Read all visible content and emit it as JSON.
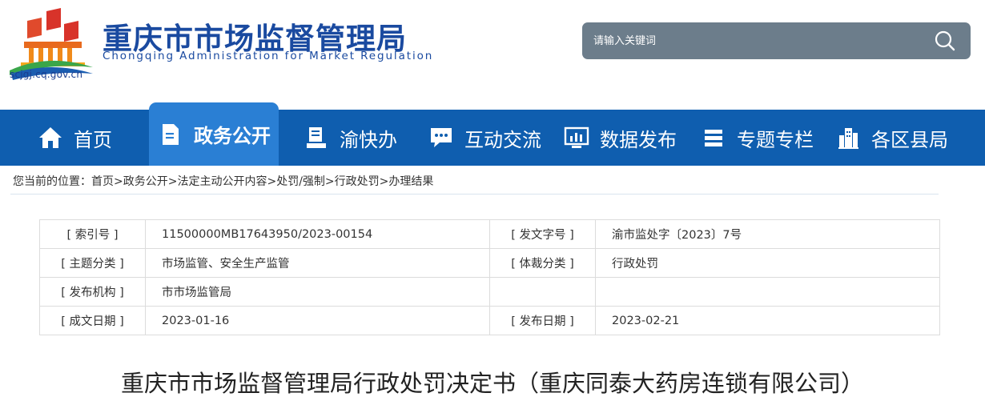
{
  "header": {
    "title_cn": "重庆市市场监督管理局",
    "title_en": "Chongqing Administration for Market Regulation",
    "site_url": "scjgj.cq.gov.cn",
    "logo_icon": "government-building-logo-icon"
  },
  "search": {
    "placeholder": "请输入关键词",
    "icon": "search-icon"
  },
  "nav": {
    "items": [
      {
        "label": "首页",
        "icon": "home-icon"
      },
      {
        "label": "政务公开",
        "icon": "document-icon",
        "active": true
      },
      {
        "label": "渝快办",
        "icon": "service-desk-icon"
      },
      {
        "label": "互动交流",
        "icon": "chat-icon"
      },
      {
        "label": "数据发布",
        "icon": "data-chart-icon"
      },
      {
        "label": "专题专栏",
        "icon": "list-icon"
      },
      {
        "label": "各区县局",
        "icon": "buildings-icon"
      }
    ]
  },
  "breadcrumb": {
    "prefix": "您当前的位置：",
    "items": [
      "首页",
      "政务公开",
      "法定主动公开内容",
      "处罚/强制",
      "行政处罚",
      "办理结果"
    ],
    "separator": ">"
  },
  "meta": {
    "rows": [
      {
        "label1": "[ 索引号 ]",
        "value1": "11500000MB17643950/2023-00154",
        "label2": "[ 发文字号 ]",
        "value2": "渝市监处字〔2023〕7号"
      },
      {
        "label1": "[ 主题分类 ]",
        "value1": "市场监管、安全生产监管",
        "label2": "[ 体裁分类 ]",
        "value2": "行政处罚"
      },
      {
        "label1": "[ 发布机构 ]",
        "value1": "市市场监管局",
        "label2": "",
        "value2": ""
      },
      {
        "label1": "[ 成文日期 ]",
        "value1": "2023-01-16",
        "label2": "[ 发布日期 ]",
        "value2": "2023-02-21"
      }
    ]
  },
  "document": {
    "title": "重庆市市场监督管理局行政处罚决定书（重庆同泰大药房连锁有限公司）"
  },
  "colors": {
    "brand_blue": "#1a4aa0",
    "nav_bg": "#0f5eaf",
    "nav_active": "#2a7fd4",
    "search_bg": "#6c7d8b"
  }
}
